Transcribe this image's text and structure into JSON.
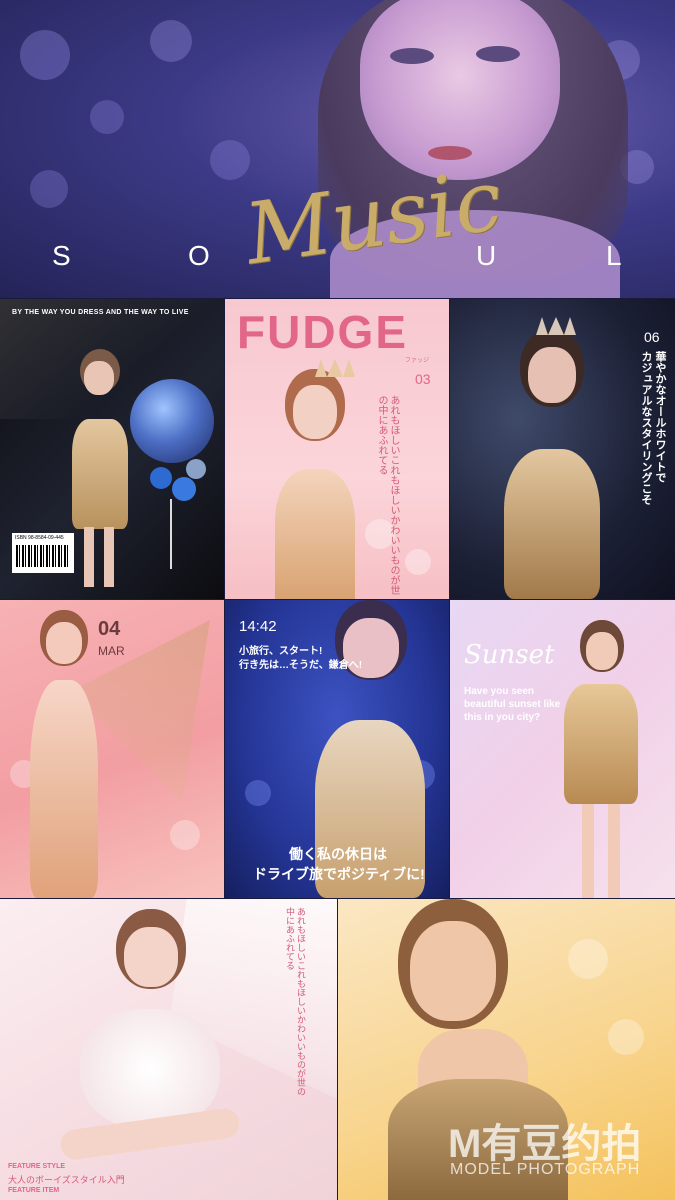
{
  "banner": {
    "soul_letters": [
      "S",
      "O",
      "U",
      "L"
    ],
    "script_title": "Music"
  },
  "cells": {
    "c1": {
      "tagline": "BY THE WAY YOU DRESS AND THE WAY TO LIVE",
      "isbn": "ISBN 98-8584-09-445"
    },
    "c2": {
      "masthead": "FUDGE",
      "kana": "ファッジ",
      "issue": "03",
      "vertical_text": "あれもほしいこれもほしいかわいいものが世の中にあふれてる"
    },
    "c3": {
      "issue": "06",
      "vertical_text_1": "華やかなオールホワイトで",
      "vertical_text_2": "カジュアルなスタイリングこそ"
    },
    "c4": {
      "date_num": "04",
      "month": "MAR"
    },
    "c5": {
      "time": "14:42",
      "headline_1": "小旅行、スタート!",
      "headline_2": "行き先は…そうだ、鎌倉へ!",
      "caption_1": "働く私の休日は",
      "caption_2": "ドライブ旅でポジティブに!"
    },
    "c6": {
      "script": "Sunset",
      "line_1": "Have you seen",
      "line_2": "beautiful sunset like",
      "line_3": "this in you city?"
    },
    "c7": {
      "feature_1": "FEATURE STYLE",
      "feature_1_sub": "大人のボーイズスタイル入門",
      "feature_2": "FEATURE ITEM",
      "vertical_text": "あれもほしいこれもほしいかわいいものが世の中にあふれてる"
    },
    "c8": {
      "watermark": "M有豆约拍",
      "watermark_sub": "MODEL PHOTOGRAPH"
    }
  },
  "colors": {
    "banner": "#3c3a86",
    "gold": "#c9ac6a",
    "pink_title": "#e2658a",
    "navy": "#243595"
  }
}
